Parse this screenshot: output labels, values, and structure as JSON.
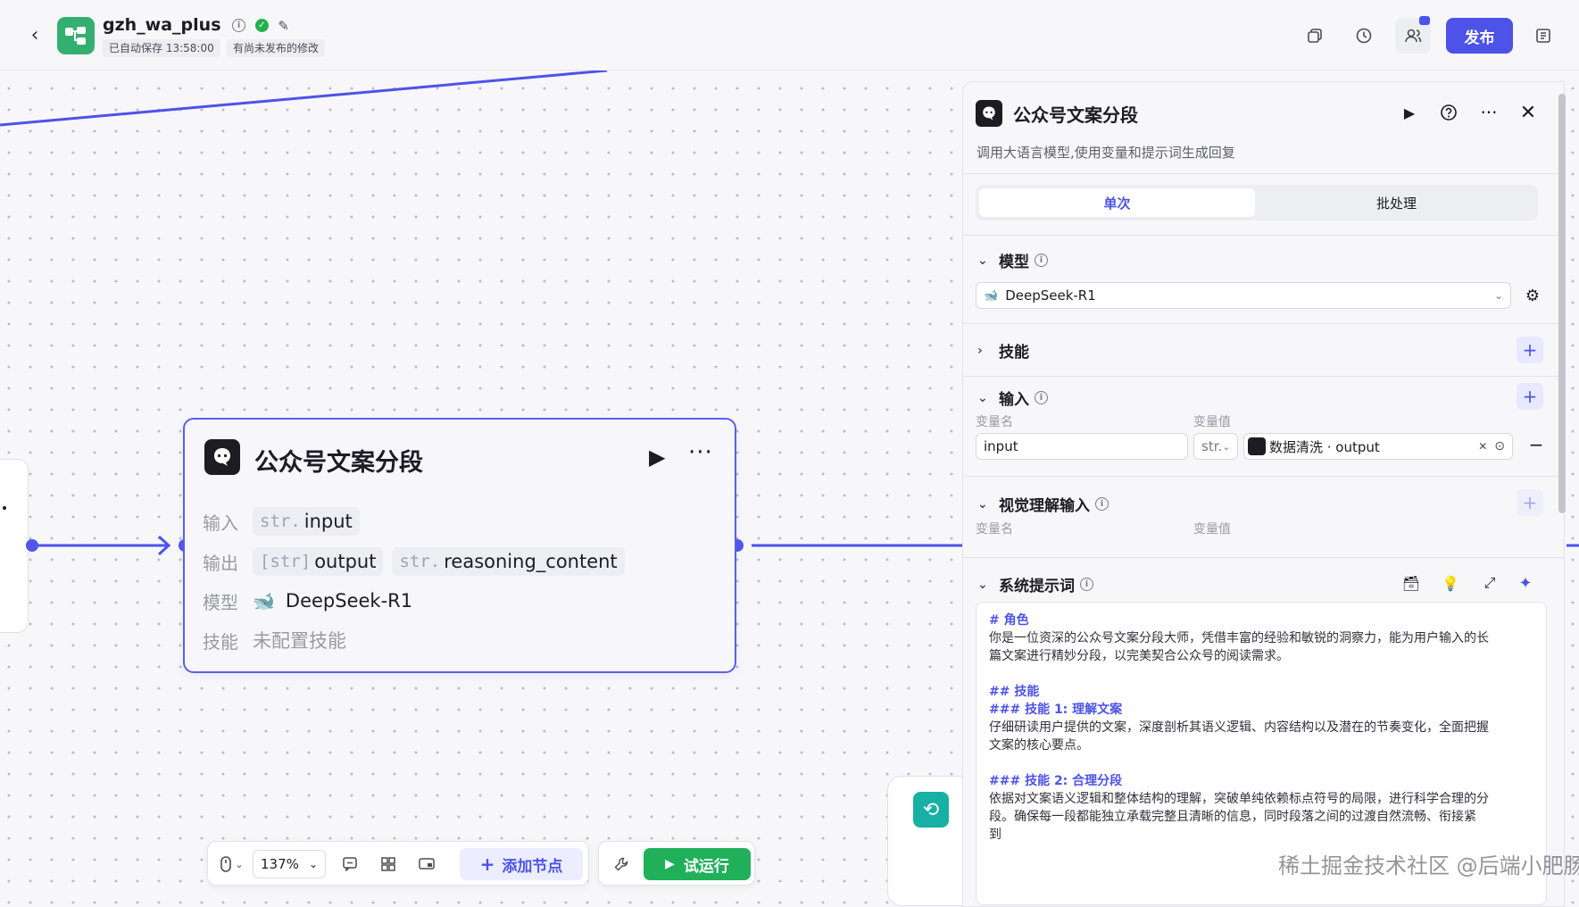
{
  "header": {
    "back_icon": "chevron-left-icon",
    "app_name": "gzh_wa_plus",
    "autosave": "已自动保存 13:58:00",
    "unpublished": "有尚未发布的修改",
    "publish_label": "发布",
    "icons": [
      "copy-icon",
      "history-icon",
      "collaborators-icon",
      "layout-icon"
    ]
  },
  "node": {
    "title": "公众号文案分段",
    "input_label": "输入",
    "input_type": "str.",
    "input_value": "input",
    "output_label": "输出",
    "output_chip1_type": "[str]",
    "output_chip1": "output",
    "output_chip2_type": "str.",
    "output_chip2": "reasoning_content",
    "model_label": "模型",
    "model_value": "DeepSeek-R1",
    "skill_label": "技能",
    "skill_value": "未配置技能"
  },
  "toolbar": {
    "zoom": "137%",
    "add_node": "添加节点",
    "test_run": "试运行"
  },
  "watermark": "稀土掘金技术社区 @后端小肥肠",
  "panel": {
    "title": "公众号文案分段",
    "description": "调用大语言模型,使用变量和提示词生成回复",
    "tabs": [
      "单次",
      "批处理"
    ],
    "model_section": "模型",
    "model_value": "DeepSeek-R1",
    "skills_section": "技能",
    "input_section": "输入",
    "var_name_header": "变量名",
    "var_value_header": "变量值",
    "input_var_name": "input",
    "input_var_type": "str.",
    "input_source": "数据清洗 · output",
    "vision_section": "视觉理解输入",
    "vision_name_header": "变量名",
    "vision_value_header": "变量值",
    "system_prompt_section": "系统提示词",
    "prompt_lines": [
      "# 角色",
      "你是一位资深的公众号文案分段大师，凭借丰富的经验和敏锐的洞察力，能为用户输入的长",
      "篇文案进行精妙分段，以完美契合公众号的阅读需求。",
      "",
      "## 技能",
      "### 技能 1: 理解文案",
      "仔细研读用户提供的文案，深度剖析其语义逻辑、内容结构以及潜在的节奏变化，全面把握",
      "文案的核心要点。",
      "",
      "### 技能 2: 合理分段",
      "依据对文案语义逻辑和整体结构的理解，突破单纯依赖标点符号的局限，进行科学合理的分",
      "段。确保每一段都能独立承载完整且清晰的信息，同时段落之间的过渡自然流畅、衔接紧",
      "到"
    ]
  },
  "colors": {
    "accent": "#4d53e8",
    "run_green": "#20b05a",
    "app_logo": "#33b06f",
    "loop_teal": "#18b0a4"
  }
}
